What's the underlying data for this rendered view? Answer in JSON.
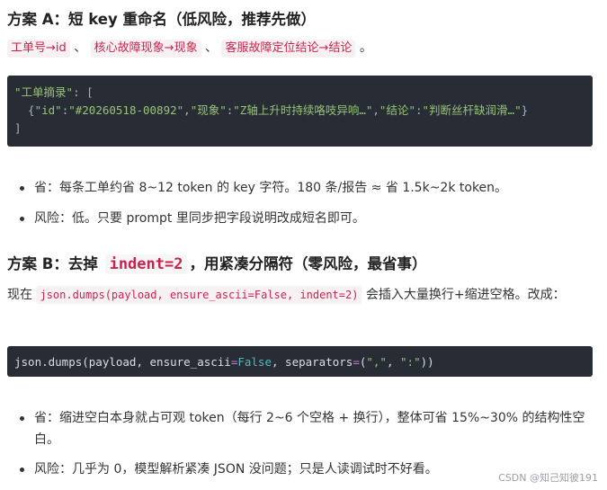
{
  "section_a": {
    "heading": "方案 A：短 key 重命名（低风险，推荐先做）",
    "mapping": [
      {
        "text": "工单号→id",
        "mono": false
      },
      {
        "text": "核心故障现象→现象",
        "mono": false
      },
      {
        "text": "客服故障定位结论→结论",
        "mono": false
      }
    ],
    "separator": "、",
    "end_punct": "。",
    "code_lines": {
      "line1_key": "\"工单摘录\"",
      "line1_rest": ": [",
      "line2_open": "  {",
      "line2_k1": "\"id\"",
      "line2_v1": "\"#20260518-00892\"",
      "line2_k2": "\"现象\"",
      "line2_v2": "\"Z轴上升时持续咯吱异响…\"",
      "line2_k3": "\"结论\"",
      "line2_v3": "\"判断丝杆缺润滑…\"",
      "line2_close": "}",
      "line3": "]"
    },
    "bullets": [
      "省：每条工单约省 8~12 token 的 key 字符。180 条/报告 ≈ 省 1.5k~2k token。",
      "风险：低。只要 prompt 里同步把字段说明改成短名即可。"
    ]
  },
  "section_b": {
    "heading_pre": "方案 B：去掉",
    "heading_code": "indent=2",
    "heading_post": "，用紧凑分隔符（零风险，最省事）",
    "para_pre": "现在",
    "para_code": "json.dumps(payload, ensure_ascii=False, indent=2)",
    "para_post": "会插入大量换行+缩进空格。改成：",
    "code_fn": "json.dumps(payload, ensure_ascii",
    "code_eq1": "=",
    "code_false": "False",
    "code_mid": ", separators",
    "code_eq2": "=",
    "code_open": "(",
    "code_s1": "\",\"",
    "code_comma": ", ",
    "code_s2": "\":\"",
    "code_close": "))",
    "bullets": [
      "省：缩进空白本身就占可观 token（每行 2~6 个空格 + 换行），整体可省 15%~30% 的结构性空白。",
      "风险：几乎为 0，模型解析紧凑 JSON 没问题；只是人读调试时不好看。"
    ]
  },
  "watermark": "CSDN @知己知彼191"
}
